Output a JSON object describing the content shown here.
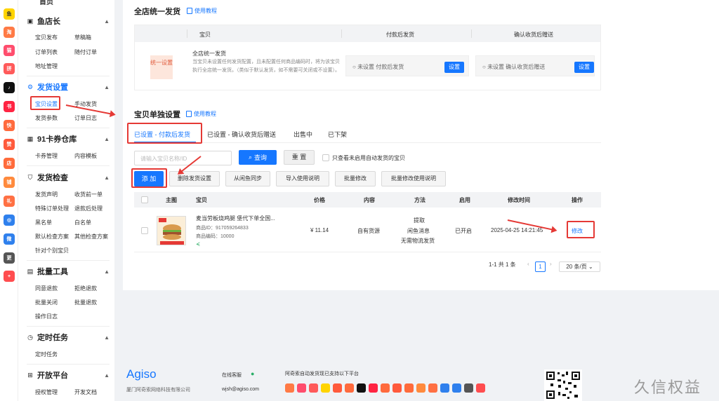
{
  "sidebar": {
    "groups": [
      {
        "title": "鱼店长",
        "icon": "shop-icon",
        "items": [
          "宝贝发布",
          "草稿箱",
          "订单列表",
          "随付订单",
          "地址管理"
        ]
      },
      {
        "title": "发货设置",
        "icon": "gear-icon",
        "items": [
          "宝贝设置",
          "手动发货",
          "发货参数",
          "订单日志"
        ]
      },
      {
        "title": "91卡券仓库",
        "icon": "grid-icon",
        "items": [
          "卡券管理",
          "内容模板"
        ]
      },
      {
        "title": "发货检查",
        "icon": "shield-icon",
        "items": [
          "发货声明",
          "收货前一单",
          "特殊订单处理",
          "退款后处理",
          "黑名单",
          "白名单",
          "默认检查方案",
          "其他检查方案",
          "针对个别宝贝"
        ]
      },
      {
        "title": "批量工具",
        "icon": "tool-icon",
        "items": [
          "同意退款",
          "拒绝退款",
          "批量关闭",
          "批量退款",
          "操作日志"
        ]
      },
      {
        "title": "定时任务",
        "icon": "clock-icon",
        "items": [
          "定时任务"
        ]
      },
      {
        "title": "开放平台",
        "icon": "api-icon",
        "items": [
          "授权管理",
          "开发文档"
        ]
      }
    ],
    "top_partial": "首页"
  },
  "unified": {
    "title": "全店统一发货",
    "tutorial": "使用教程",
    "headers": [
      "宝贝",
      "付款后发货",
      "确认收货后赠送"
    ],
    "tag": "统一设置",
    "desc_title": "全店统一发货",
    "desc_body": "当宝贝未设置任何发货配置，且未配置任何商品编码时，将为该宝贝执行全店统一发货。（类似于默认发货，如不需要可关闭或不设置）。",
    "box1": "未设置 付款后发货",
    "box2": "未设置 确认收货后赠送",
    "set_label": "设置"
  },
  "single": {
    "title": "宝贝单独设置",
    "tutorial": "使用教程",
    "tabs": [
      "已设置 - 付款后发货",
      "已设置 - 确认收货后赠送",
      "出售中",
      "已下架"
    ],
    "search_placeholder": "请输入宝贝名称/ID",
    "query": "查询",
    "reset": "重 置",
    "only_unenabled": "只查看未启用自动发货的宝贝",
    "actions": [
      "添 加",
      "删除发货设置",
      "从闲鱼同步",
      "导入使用说明",
      "批量修改",
      "批量修改使用说明"
    ],
    "columns": [
      "主图",
      "宝贝",
      "价格",
      "内容",
      "方法",
      "启用",
      "修改时间",
      "操作"
    ],
    "rows": [
      {
        "name": "麦当劳板烧鸡腿 堡代下单全国...",
        "id": "商品ID：917059264833",
        "code": "商品编码：10000",
        "price": "¥ 11.14",
        "content": "自有货源",
        "method": [
          "提取",
          "闲鱼消息",
          "无需物流发货"
        ],
        "enabled": "已开启",
        "modified": "2025-04-25 14:21:45",
        "action": "修改"
      }
    ],
    "pagination": {
      "summary": "1-1 共 1 条",
      "page": "1",
      "page_size": "20 条/页"
    }
  },
  "footer": {
    "logo": "Agiso",
    "company": "厦门阿奇索网络科技有限公司",
    "support_label": "在线客服",
    "email": "wjsh@agiso.com",
    "platforms_label": "阿奇索自动发货现已支持以下平台",
    "watermark": "久信权益"
  }
}
